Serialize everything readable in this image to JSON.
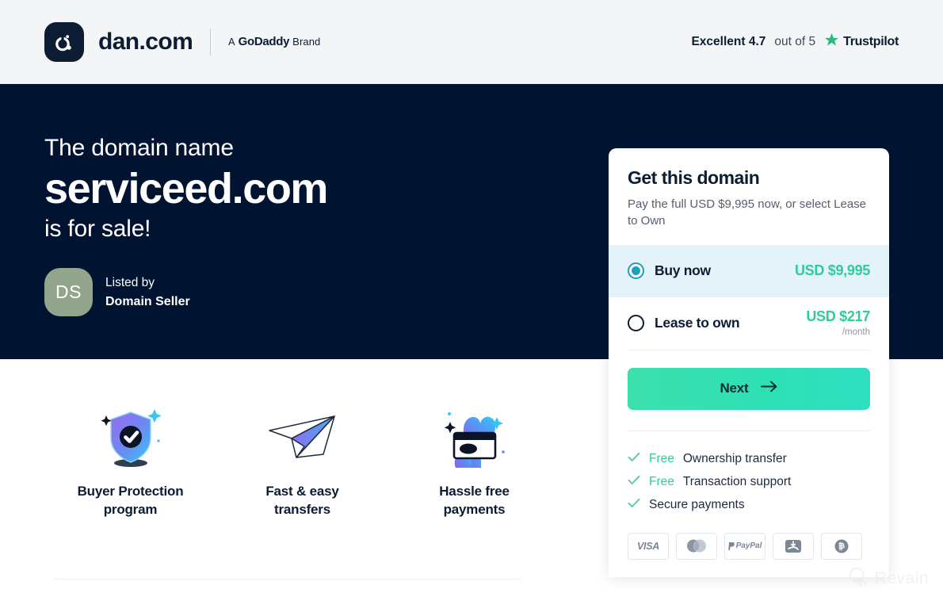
{
  "header": {
    "logo_icon": "dan-logo-icon",
    "brand_name": "dan.com",
    "godaddy_a": "A",
    "godaddy_name": "GoDaddy",
    "godaddy_brand": "Brand",
    "trust_excellent": "Excellent 4.7",
    "trust_outof": "out of 5",
    "trust_star_icon": "trustpilot-star-icon",
    "trust_brand": "Trustpilot"
  },
  "hero": {
    "line1": "The domain name",
    "domain": "serviceed.com",
    "line3": "is for sale!",
    "seller": {
      "avatar_initials": "DS",
      "listed_by_label": "Listed by",
      "name": "Domain Seller",
      "avatar_color": "#93a58d"
    }
  },
  "features": [
    {
      "icon": "shield-check-icon",
      "label": "Buyer Protection\nprogram"
    },
    {
      "icon": "paper-plane-icon",
      "label": "Fast & easy\ntransfers"
    },
    {
      "icon": "hand-credit-card-icon",
      "label": "Hassle free\npayments"
    }
  ],
  "card": {
    "title": "Get this domain",
    "subtitle": "Pay the full USD $9,995 now, or select Lease to Own",
    "options": [
      {
        "label": "Buy now",
        "price": "USD $9,995",
        "per": "",
        "selected": true
      },
      {
        "label": "Lease to own",
        "price": "USD $217",
        "per": "/month",
        "selected": false
      }
    ],
    "next_label": "Next",
    "next_icon": "arrow-right-icon",
    "next_color": "#2fe0b5",
    "accent_price_color": "#2ecc9b",
    "selected_row_color": "#e4f3fa",
    "benefits": [
      {
        "free": "Free",
        "text": "Ownership transfer"
      },
      {
        "free": "Free",
        "text": "Transaction support"
      },
      {
        "free": "",
        "text": "Secure payments"
      }
    ],
    "payment_methods": [
      {
        "icon": "visa-icon",
        "label": "VISA"
      },
      {
        "icon": "mastercard-icon",
        "label": ""
      },
      {
        "icon": "paypal-icon",
        "label": "PayPal"
      },
      {
        "icon": "alipay-icon",
        "label": ""
      },
      {
        "icon": "bitcoin-icon",
        "label": ""
      }
    ]
  },
  "watermark": {
    "icon": "revain-logo-icon",
    "text": "Revain"
  }
}
